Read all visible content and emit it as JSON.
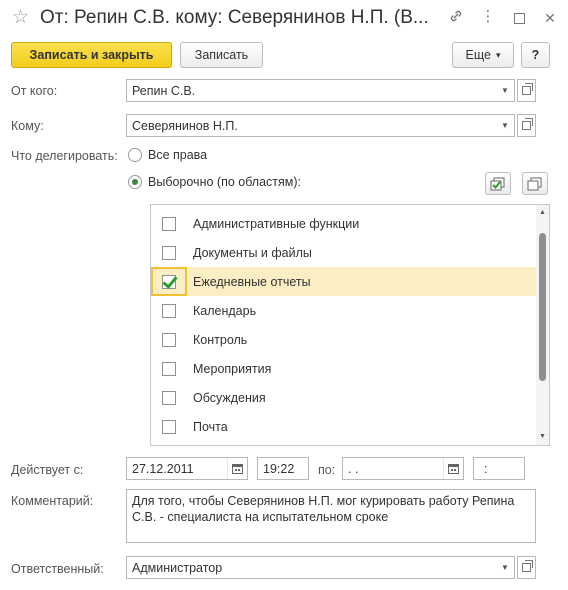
{
  "window": {
    "title": "От: Репин С.В. кому: Северянинов Н.П. (В...",
    "star_glyph": "☆",
    "link_glyph": "🔗",
    "more_glyph": "⋮",
    "maximize_glyph": "☐",
    "close_glyph": "✕"
  },
  "toolbar": {
    "save_close_label": "Записать и закрыть",
    "save_label": "Записать",
    "more_label": "Еще",
    "more_arrow": "▾",
    "help_label": "?"
  },
  "form": {
    "from_label": "От кого:",
    "from_value": "Репин С.В.",
    "to_label": "Кому:",
    "to_value": "Северянинов Н.П.",
    "what_label": "Что делегировать:",
    "options": [
      {
        "label": "Все права",
        "selected": false
      },
      {
        "label": "Выборочно (по областям):",
        "selected": true
      }
    ],
    "areas": [
      {
        "label": "Административные функции",
        "checked": false
      },
      {
        "label": "Документы и файлы",
        "checked": false
      },
      {
        "label": "Ежедневные отчеты",
        "checked": true
      },
      {
        "label": "Календарь",
        "checked": false
      },
      {
        "label": "Контроль",
        "checked": false
      },
      {
        "label": "Мероприятия",
        "checked": false
      },
      {
        "label": "Обсуждения",
        "checked": false
      },
      {
        "label": "Почта",
        "checked": false
      }
    ],
    "valid_label": "Действует с:",
    "valid_from_date": "27.12.2011",
    "valid_from_time": "19:22",
    "to_date_label": "по:",
    "valid_to_date": " .  . ",
    "valid_to_time": " : ",
    "comment_label": "Комментарий:",
    "comment_value": "Для того, чтобы Северянинов Н.П. мог курировать работу Репина\nС.В. - специалиста на испытательном сроке",
    "responsible_label": "Ответственный:",
    "responsible_value": "Администратор"
  },
  "colors": {
    "primary_button": "#f3cc1d",
    "selected_row": "#fbeec4",
    "check": "#2e9b2e"
  }
}
